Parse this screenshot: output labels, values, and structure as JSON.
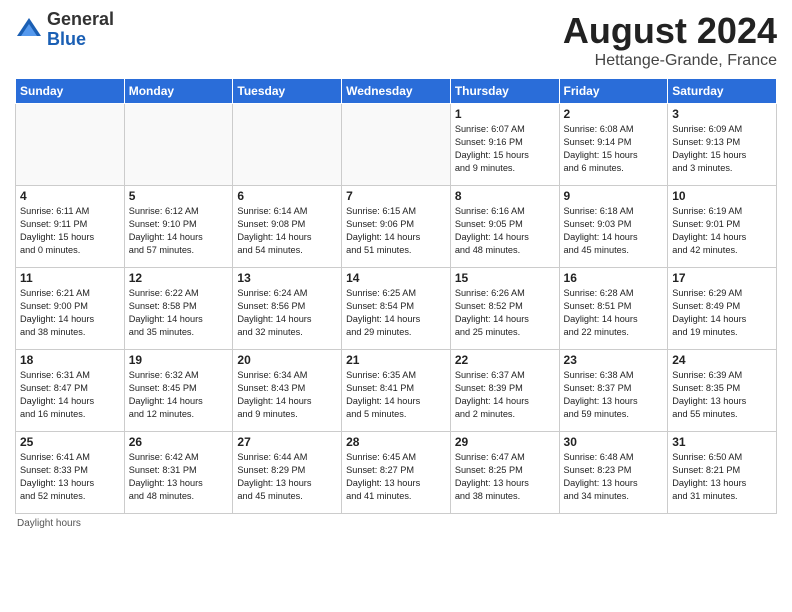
{
  "header": {
    "logo_line1": "General",
    "logo_line2": "Blue",
    "main_title": "August 2024",
    "subtitle": "Hettange-Grande, France"
  },
  "days_of_week": [
    "Sunday",
    "Monday",
    "Tuesday",
    "Wednesday",
    "Thursday",
    "Friday",
    "Saturday"
  ],
  "weeks": [
    [
      {
        "day": "",
        "info": ""
      },
      {
        "day": "",
        "info": ""
      },
      {
        "day": "",
        "info": ""
      },
      {
        "day": "",
        "info": ""
      },
      {
        "day": "1",
        "info": "Sunrise: 6:07 AM\nSunset: 9:16 PM\nDaylight: 15 hours\nand 9 minutes."
      },
      {
        "day": "2",
        "info": "Sunrise: 6:08 AM\nSunset: 9:14 PM\nDaylight: 15 hours\nand 6 minutes."
      },
      {
        "day": "3",
        "info": "Sunrise: 6:09 AM\nSunset: 9:13 PM\nDaylight: 15 hours\nand 3 minutes."
      }
    ],
    [
      {
        "day": "4",
        "info": "Sunrise: 6:11 AM\nSunset: 9:11 PM\nDaylight: 15 hours\nand 0 minutes."
      },
      {
        "day": "5",
        "info": "Sunrise: 6:12 AM\nSunset: 9:10 PM\nDaylight: 14 hours\nand 57 minutes."
      },
      {
        "day": "6",
        "info": "Sunrise: 6:14 AM\nSunset: 9:08 PM\nDaylight: 14 hours\nand 54 minutes."
      },
      {
        "day": "7",
        "info": "Sunrise: 6:15 AM\nSunset: 9:06 PM\nDaylight: 14 hours\nand 51 minutes."
      },
      {
        "day": "8",
        "info": "Sunrise: 6:16 AM\nSunset: 9:05 PM\nDaylight: 14 hours\nand 48 minutes."
      },
      {
        "day": "9",
        "info": "Sunrise: 6:18 AM\nSunset: 9:03 PM\nDaylight: 14 hours\nand 45 minutes."
      },
      {
        "day": "10",
        "info": "Sunrise: 6:19 AM\nSunset: 9:01 PM\nDaylight: 14 hours\nand 42 minutes."
      }
    ],
    [
      {
        "day": "11",
        "info": "Sunrise: 6:21 AM\nSunset: 9:00 PM\nDaylight: 14 hours\nand 38 minutes."
      },
      {
        "day": "12",
        "info": "Sunrise: 6:22 AM\nSunset: 8:58 PM\nDaylight: 14 hours\nand 35 minutes."
      },
      {
        "day": "13",
        "info": "Sunrise: 6:24 AM\nSunset: 8:56 PM\nDaylight: 14 hours\nand 32 minutes."
      },
      {
        "day": "14",
        "info": "Sunrise: 6:25 AM\nSunset: 8:54 PM\nDaylight: 14 hours\nand 29 minutes."
      },
      {
        "day": "15",
        "info": "Sunrise: 6:26 AM\nSunset: 8:52 PM\nDaylight: 14 hours\nand 25 minutes."
      },
      {
        "day": "16",
        "info": "Sunrise: 6:28 AM\nSunset: 8:51 PM\nDaylight: 14 hours\nand 22 minutes."
      },
      {
        "day": "17",
        "info": "Sunrise: 6:29 AM\nSunset: 8:49 PM\nDaylight: 14 hours\nand 19 minutes."
      }
    ],
    [
      {
        "day": "18",
        "info": "Sunrise: 6:31 AM\nSunset: 8:47 PM\nDaylight: 14 hours\nand 16 minutes."
      },
      {
        "day": "19",
        "info": "Sunrise: 6:32 AM\nSunset: 8:45 PM\nDaylight: 14 hours\nand 12 minutes."
      },
      {
        "day": "20",
        "info": "Sunrise: 6:34 AM\nSunset: 8:43 PM\nDaylight: 14 hours\nand 9 minutes."
      },
      {
        "day": "21",
        "info": "Sunrise: 6:35 AM\nSunset: 8:41 PM\nDaylight: 14 hours\nand 5 minutes."
      },
      {
        "day": "22",
        "info": "Sunrise: 6:37 AM\nSunset: 8:39 PM\nDaylight: 14 hours\nand 2 minutes."
      },
      {
        "day": "23",
        "info": "Sunrise: 6:38 AM\nSunset: 8:37 PM\nDaylight: 13 hours\nand 59 minutes."
      },
      {
        "day": "24",
        "info": "Sunrise: 6:39 AM\nSunset: 8:35 PM\nDaylight: 13 hours\nand 55 minutes."
      }
    ],
    [
      {
        "day": "25",
        "info": "Sunrise: 6:41 AM\nSunset: 8:33 PM\nDaylight: 13 hours\nand 52 minutes."
      },
      {
        "day": "26",
        "info": "Sunrise: 6:42 AM\nSunset: 8:31 PM\nDaylight: 13 hours\nand 48 minutes."
      },
      {
        "day": "27",
        "info": "Sunrise: 6:44 AM\nSunset: 8:29 PM\nDaylight: 13 hours\nand 45 minutes."
      },
      {
        "day": "28",
        "info": "Sunrise: 6:45 AM\nSunset: 8:27 PM\nDaylight: 13 hours\nand 41 minutes."
      },
      {
        "day": "29",
        "info": "Sunrise: 6:47 AM\nSunset: 8:25 PM\nDaylight: 13 hours\nand 38 minutes."
      },
      {
        "day": "30",
        "info": "Sunrise: 6:48 AM\nSunset: 8:23 PM\nDaylight: 13 hours\nand 34 minutes."
      },
      {
        "day": "31",
        "info": "Sunrise: 6:50 AM\nSunset: 8:21 PM\nDaylight: 13 hours\nand 31 minutes."
      }
    ]
  ],
  "footer": {
    "note": "Daylight hours"
  }
}
